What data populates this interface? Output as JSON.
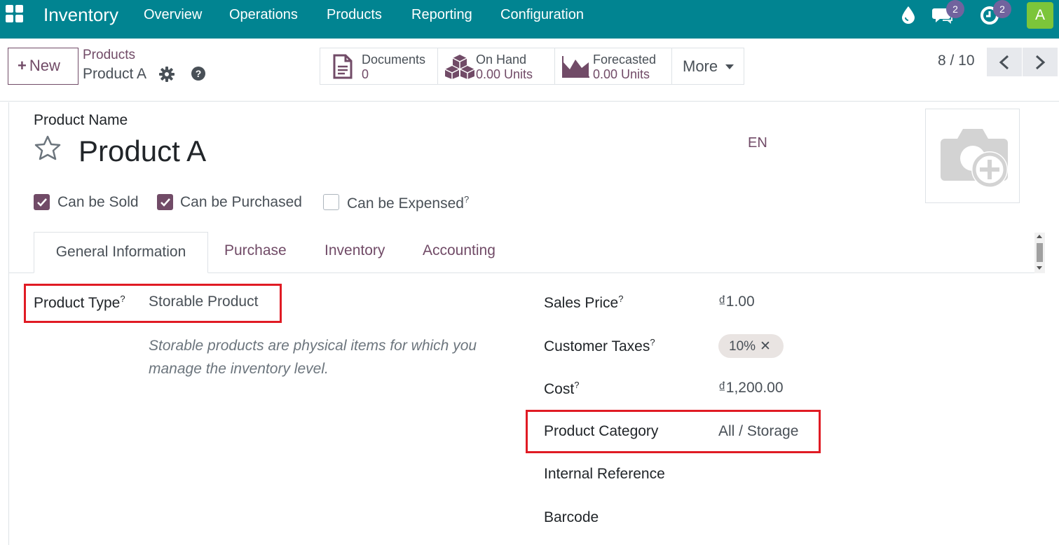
{
  "navbar": {
    "brand": "Inventory",
    "menu": [
      "Overview",
      "Operations",
      "Products",
      "Reporting",
      "Configuration"
    ],
    "chat_badge": "2",
    "activity_badge": "2",
    "avatar_letter": "A",
    "bg_color": "#018491"
  },
  "control_panel": {
    "new_label": "New",
    "breadcrumb_parent": "Products",
    "breadcrumb_current": "Product A",
    "smart_buttons": [
      {
        "label": "Documents",
        "value": "0"
      },
      {
        "label": "On Hand",
        "value": "0.00 Units"
      },
      {
        "label": "Forecasted",
        "value": "0.00 Units"
      }
    ],
    "more_label": "More",
    "pager": "8 / 10"
  },
  "form": {
    "name_label": "Product Name",
    "product_name": "Product A",
    "lang": "EN",
    "checkboxes": [
      {
        "label": "Can be Sold",
        "checked": true
      },
      {
        "label": "Can be Purchased",
        "checked": true
      },
      {
        "label": "Can be Expensed",
        "checked": false,
        "tooltip": "?"
      }
    ],
    "tabs": [
      "General Information",
      "Purchase",
      "Inventory",
      "Accounting"
    ],
    "active_tab": "General Information",
    "left": {
      "product_type_label": "Product Type",
      "product_type_value": "Storable Product",
      "product_type_help": "Storable products are physical items for which you manage the inventory level."
    },
    "right": {
      "sales_price_label": "Sales Price",
      "sales_price_value": "₫1.00",
      "taxes_label": "Customer Taxes",
      "taxes_tag": "10%",
      "cost_label": "Cost",
      "cost_value": "₫1,200.00",
      "category_label": "Product Category",
      "category_value": "All / Storage",
      "internal_ref_label": "Internal Reference",
      "barcode_label": "Barcode"
    },
    "tooltip_mark": "?"
  },
  "colors": {
    "accent": "#714b67",
    "highlight": "#e01b24"
  }
}
